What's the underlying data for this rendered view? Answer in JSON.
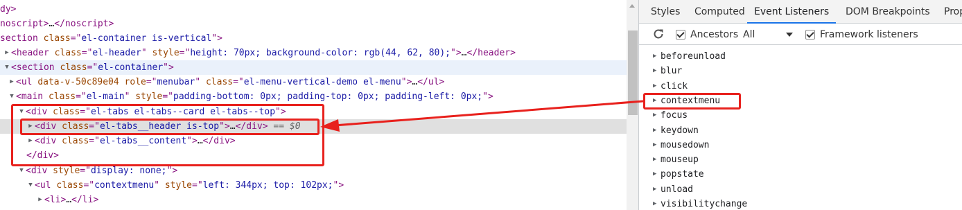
{
  "elements_panel": {
    "lines": [
      {
        "type": "raw",
        "html_parts": [
          {
            "c": "tag",
            "t": "dy>"
          }
        ]
      },
      {
        "type": "raw",
        "html_parts": [
          {
            "c": "tag",
            "t": "noscript>"
          },
          {
            "c": "text",
            "t": "…"
          },
          {
            "c": "tag",
            "t": "</noscript>"
          }
        ]
      },
      {
        "type": "raw",
        "html_parts": [
          {
            "c": "tag",
            "t": "section "
          },
          {
            "c": "attr-name",
            "t": "class"
          },
          {
            "c": "tag",
            "t": "=\""
          },
          {
            "c": "attr-val",
            "t": "el-container is-vertical"
          },
          {
            "c": "tag",
            "t": "\">"
          }
        ]
      },
      {
        "type": "raw",
        "html_parts": [
          {
            "c": "tri",
            "t": "▶"
          },
          {
            "c": "tag",
            "t": "<header "
          },
          {
            "c": "attr-name",
            "t": "class"
          },
          {
            "c": "tag",
            "t": "=\""
          },
          {
            "c": "attr-val",
            "t": "el-header"
          },
          {
            "c": "tag",
            "t": "\" "
          },
          {
            "c": "attr-name",
            "t": "style"
          },
          {
            "c": "tag",
            "t": "=\""
          },
          {
            "c": "attr-val",
            "t": "height: 70px; background-color: rgb(44, 62, 80);"
          },
          {
            "c": "tag",
            "t": "\">"
          },
          {
            "c": "text",
            "t": "…"
          },
          {
            "c": "tag",
            "t": "</header>"
          }
        ]
      },
      {
        "type": "raw",
        "html_parts": [
          {
            "c": "tri",
            "t": "▼"
          },
          {
            "c": "tag",
            "t": "<section "
          },
          {
            "c": "attr-name",
            "t": "class"
          },
          {
            "c": "tag",
            "t": "=\""
          },
          {
            "c": "attr-val",
            "t": "el-container"
          },
          {
            "c": "tag",
            "t": "\">"
          }
        ]
      },
      {
        "type": "raw",
        "html_parts": [
          {
            "c": "tri",
            "t": "▶"
          },
          {
            "c": "tag",
            "t": "<ul "
          },
          {
            "c": "attr-name",
            "t": "data-v-50c89e04 role"
          },
          {
            "c": "tag",
            "t": "=\""
          },
          {
            "c": "attr-val",
            "t": "menubar"
          },
          {
            "c": "tag",
            "t": "\" "
          },
          {
            "c": "attr-name",
            "t": "class"
          },
          {
            "c": "tag",
            "t": "=\""
          },
          {
            "c": "attr-val",
            "t": "el-menu-vertical-demo el-menu"
          },
          {
            "c": "tag",
            "t": "\">"
          },
          {
            "c": "text",
            "t": "…"
          },
          {
            "c": "tag",
            "t": "</ul>"
          }
        ]
      },
      {
        "type": "raw",
        "html_parts": [
          {
            "c": "tri",
            "t": "▼"
          },
          {
            "c": "tag",
            "t": "<main "
          },
          {
            "c": "attr-name",
            "t": "class"
          },
          {
            "c": "tag",
            "t": "=\""
          },
          {
            "c": "attr-val",
            "t": "el-main"
          },
          {
            "c": "tag",
            "t": "\" "
          },
          {
            "c": "attr-name",
            "t": "style"
          },
          {
            "c": "tag",
            "t": "=\""
          },
          {
            "c": "attr-val",
            "t": "padding-bottom: 0px; padding-top: 0px; padding-left: 0px;"
          },
          {
            "c": "tag",
            "t": "\">"
          }
        ]
      },
      {
        "type": "raw",
        "html_parts": [
          {
            "c": "tri",
            "t": "▼"
          },
          {
            "c": "tag",
            "t": "<div "
          },
          {
            "c": "attr-name",
            "t": "class"
          },
          {
            "c": "tag",
            "t": "=\""
          },
          {
            "c": "attr-val",
            "t": "el-tabs el-tabs--card el-tabs--top"
          },
          {
            "c": "tag",
            "t": "\">"
          }
        ]
      },
      {
        "type": "raw",
        "html_parts": [
          {
            "c": "tri",
            "t": "▶"
          },
          {
            "c": "tag",
            "t": "<div "
          },
          {
            "c": "attr-name",
            "t": "class"
          },
          {
            "c": "tag",
            "t": "=\""
          },
          {
            "c": "attr-val",
            "t": "el-tabs__header is-top"
          },
          {
            "c": "tag",
            "t": "\">"
          },
          {
            "c": "text",
            "t": "…"
          },
          {
            "c": "tag",
            "t": "</div>"
          },
          {
            "c": "eq0",
            "t": " == $0"
          }
        ]
      },
      {
        "type": "raw",
        "html_parts": [
          {
            "c": "tri",
            "t": "▶"
          },
          {
            "c": "tag",
            "t": "<div "
          },
          {
            "c": "attr-name",
            "t": "class"
          },
          {
            "c": "tag",
            "t": "=\""
          },
          {
            "c": "attr-val",
            "t": "el-tabs__content"
          },
          {
            "c": "tag",
            "t": "\">"
          },
          {
            "c": "text",
            "t": "…"
          },
          {
            "c": "tag",
            "t": "</div>"
          }
        ]
      },
      {
        "type": "raw",
        "html_parts": [
          {
            "c": "tag",
            "t": "</div>"
          }
        ]
      },
      {
        "type": "raw",
        "html_parts": [
          {
            "c": "tri",
            "t": "▼"
          },
          {
            "c": "tag",
            "t": "<div "
          },
          {
            "c": "attr-name",
            "t": "style"
          },
          {
            "c": "tag",
            "t": "=\""
          },
          {
            "c": "attr-val",
            "t": "display: none;"
          },
          {
            "c": "tag",
            "t": "\">"
          }
        ]
      },
      {
        "type": "raw",
        "html_parts": [
          {
            "c": "tri",
            "t": "▼"
          },
          {
            "c": "tag",
            "t": "<ul "
          },
          {
            "c": "attr-name",
            "t": "class"
          },
          {
            "c": "tag",
            "t": "=\""
          },
          {
            "c": "attr-val",
            "t": "contextmenu"
          },
          {
            "c": "tag",
            "t": "\" "
          },
          {
            "c": "attr-name",
            "t": "style"
          },
          {
            "c": "tag",
            "t": "=\""
          },
          {
            "c": "attr-val",
            "t": "left: 344px; top: 102px;"
          },
          {
            "c": "tag",
            "t": "\">"
          }
        ]
      },
      {
        "type": "raw",
        "html_parts": [
          {
            "c": "tri",
            "t": "▶"
          },
          {
            "c": "tag",
            "t": "<li>"
          },
          {
            "c": "text",
            "t": "…"
          },
          {
            "c": "tag",
            "t": "</li>"
          }
        ]
      }
    ]
  },
  "sidebar": {
    "tabs": [
      "Styles",
      "Computed",
      "Event Listeners",
      "DOM Breakpoints",
      "Prop"
    ],
    "active_tab": "Event Listeners",
    "toolbar": {
      "ancestors_label": "Ancestors",
      "ancestors_checked": true,
      "filter_value": "All",
      "framework_label": "Framework listeners",
      "framework_checked": true
    },
    "listeners": [
      "beforeunload",
      "blur",
      "click",
      "contextmenu",
      "focus",
      "keydown",
      "mousedown",
      "mouseup",
      "popstate",
      "unload",
      "visibilitychange"
    ],
    "highlighted_listener": "contextmenu"
  },
  "colors": {
    "annotation": "#e8211d",
    "active_tab_underline": "#1a73e8",
    "selected_row": "#e0e0e0"
  }
}
